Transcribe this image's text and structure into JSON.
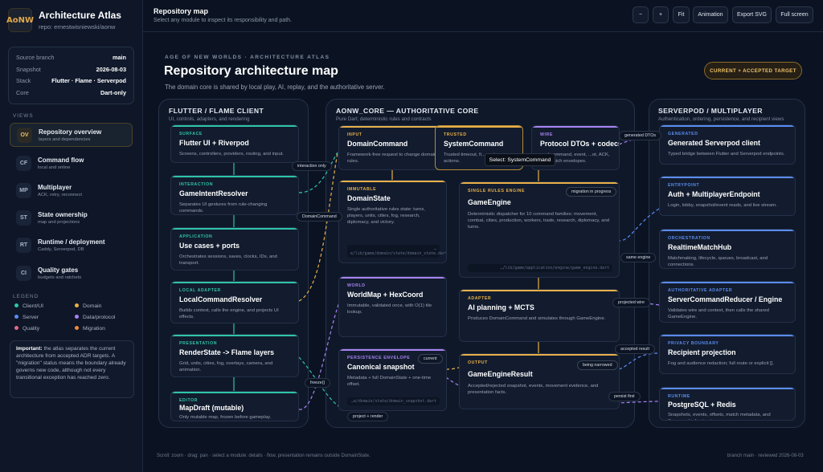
{
  "brand": {
    "logo": "AoNW",
    "title": "Architecture Atlas",
    "repo": "repo: ernestwisniewski/aonw"
  },
  "meta": [
    {
      "k": "Source branch",
      "v": "main"
    },
    {
      "k": "Snapshot",
      "v": "2026-08-03"
    },
    {
      "k": "Stack",
      "v": "Flutter · Flame · Serverpod"
    },
    {
      "k": "Core",
      "v": "Dart-only"
    }
  ],
  "views_heading": "VIEWS",
  "views": [
    {
      "ab": "OV",
      "t": "Repository overview",
      "s": "layers and dependencies",
      "active": true
    },
    {
      "ab": "CF",
      "t": "Command flow",
      "s": "local and online"
    },
    {
      "ab": "MP",
      "t": "Multiplayer",
      "s": "ACK, retry, reconnect"
    },
    {
      "ab": "ST",
      "t": "State ownership",
      "s": "map and projections"
    },
    {
      "ab": "RT",
      "t": "Runtime / deployment",
      "s": "Caddy, Serverpod, DB"
    },
    {
      "ab": "CI",
      "t": "Quality gates",
      "s": "budgets and ratchets"
    }
  ],
  "legend_heading": "LEGEND",
  "legend": [
    {
      "label": "Client/UI",
      "color": "#2fc4a8"
    },
    {
      "label": "Domain",
      "color": "#e8b04a"
    },
    {
      "label": "Server",
      "color": "#5b8cf0"
    },
    {
      "label": "Data/protocol",
      "color": "#a883f2"
    },
    {
      "label": "Quality",
      "color": "#e36a86"
    },
    {
      "label": "Migration",
      "color": "#f08a3c"
    }
  ],
  "note": {
    "bold": "Important:",
    "text": " the atlas separates the current architecture from accepted ADR targets. A \"migration\" status means the boundary already governs new code, although not every transitional exception has reached zero."
  },
  "topbar": {
    "title": "Repository map",
    "subtitle": "Select any module to inspect its responsibility and path.",
    "buttons": [
      "−",
      "+",
      "Fit",
      "Animation",
      "Export SVG",
      "Full screen"
    ]
  },
  "header": {
    "kicker": "AGE OF NEW WORLDS · ARCHITECTURE ATLAS",
    "title": "Repository architecture map",
    "subtitle": "The domain core is shared by local play, AI, replay, and the authoritative server.",
    "badge": "CURRENT + ACCEPTED TARGET"
  },
  "lanes": {
    "client": {
      "title": "FLUTTER / FLAME CLIENT",
      "sub": "UI, controls, adapters, and rendering"
    },
    "core": {
      "title": "AONW_CORE — AUTHORITATIVE CORE",
      "sub": "Pure Dart; deterministic rules and contracts"
    },
    "server": {
      "title": "SERVERPOD / MULTIPLAYER",
      "sub": "Authentication, ordering, persistence, and recipient views"
    }
  },
  "cards": {
    "surface": {
      "tag": "SURFACE",
      "name": "Flutter UI + Riverpod",
      "desc": "Screens, controllers, providers, routing, and input."
    },
    "interaction": {
      "tag": "INTERACTION",
      "name": "GameIntentResolver",
      "desc": "Separates UI gestures from rule-changing commands."
    },
    "application": {
      "tag": "APPLICATION",
      "name": "Use cases + ports",
      "desc": "Orchestrates sessions, saves, clocks, IDs, and transport."
    },
    "local_adapter": {
      "tag": "LOCAL ADAPTER",
      "name": "LocalCommandResolver",
      "desc": "Builds context, calls the engine, and projects UI effects."
    },
    "presentation": {
      "tag": "PRESENTATION",
      "name": "RenderState -> Flame layers",
      "desc": "Grid, units, cities, fog, overlays, camera, and animation."
    },
    "editor": {
      "tag": "EDITOR",
      "name": "MapDraft (mutable)",
      "desc": "Only mutable map, frozen before gameplay."
    },
    "input": {
      "tag": "INPUT",
      "name": "DomainCommand",
      "desc": "Framework-free request to change domain rules."
    },
    "trusted": {
      "tag": "TRUSTED",
      "name": "SystemCommand",
      "desc": "Trusted timeout, fi... system actions."
    },
    "wire": {
      "tag": "WIRE",
      "name": "Protocol DTOs + codecs",
      "desc": "...nd command, event, ...ot, ACK, and match envelopes."
    },
    "immutable": {
      "tag": "IMMUTABLE",
      "name": "DomainState",
      "desc": "Single authoritative rules state: turns, players, units, cities, fog, research, diplomacy, and victory.",
      "path": "…e/lib/game/domain/state/domain_state.dart"
    },
    "engine": {
      "tag": "SINGLE RULES ENGINE",
      "name": "GameEngine",
      "desc": "Deterministic dispatcher for 10 command families: movement, combat, cities, production, workers, trade, research, diplomacy, and turns.",
      "status": "migration in progress",
      "path": "…/lib/game/application/engine/game_engine.dart"
    },
    "world": {
      "tag": "WORLD",
      "name": "WorldMap + HexCoord",
      "desc": "Immutable, validated once, with O(1) tile lookup."
    },
    "adapter": {
      "tag": "ADAPTER",
      "name": "AI planning + MCTS",
      "desc": "Produces DomainCommand and simulates through GameEngine."
    },
    "persistence": {
      "tag": "PERSISTENCE ENVELOPE",
      "name": "Canonical snapshot",
      "desc": "Metadata + full DomainState + one-time offset.",
      "status": "current",
      "path": "…e/domain/state/domain_snapshot.dart"
    },
    "output": {
      "tag": "OUTPUT",
      "name": "GameEngineResult",
      "desc": "Accepted/rejected snapshot, events, movement evidence, and presentation facts.",
      "status": "being narrowed"
    },
    "generated": {
      "tag": "GENERATED",
      "name": "Generated Serverpod client",
      "desc": "Typed bridge between Flutter and Serverpod endpoints."
    },
    "entrypoint": {
      "tag": "ENTRYPOINT",
      "name": "Auth + MultiplayerEndpoint",
      "desc": "Login, lobby, snapshot/event reads, and live stream."
    },
    "orchestration": {
      "tag": "ORCHESTRATION",
      "name": "RealtimeMatchHub",
      "desc": "Matchmaking, lifecycle, queues, broadcast, and connections."
    },
    "auth_adapter": {
      "tag": "AUTHORITATIVE ADAPTER",
      "name": "ServerCommandReducer / Engine",
      "desc": "Validates wire and context, then calls the shared GameEngine."
    },
    "privacy": {
      "tag": "PRIVACY BOUNDARY",
      "name": "Recipient projection",
      "desc": "Fog and audience redaction; full route or explicit []."
    },
    "runtime": {
      "tag": "RUNTIME",
      "name": "PostgreSQL + Redis",
      "desc": "Snapshots, events, offsets, match metadata, and Serverpod infrastructure."
    }
  },
  "edges": {
    "interaction_only": "interaction only",
    "domaincommand": "DomainCommand",
    "generated_dtos": "generated DTOs",
    "same_engine": "same engine",
    "projected_wire": "projected wire",
    "accepted_result": "accepted result",
    "persist_first": "persist first",
    "freeze": "freeze()",
    "project_render": "project + render"
  },
  "tooltip": "Select: SystemCommand",
  "footer": {
    "left": "Scroll: zoom · drag: pan · select a module: details · flow, presentation remains outside DomainState.",
    "right": "branch main · reviewed 2026-08-03"
  }
}
